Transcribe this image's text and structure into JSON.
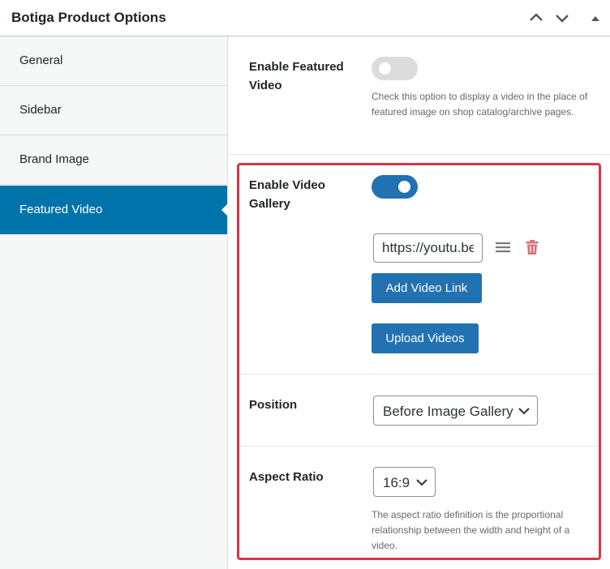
{
  "header": {
    "title": "Botiga Product Options"
  },
  "sidebar": {
    "items": [
      {
        "label": "General"
      },
      {
        "label": "Sidebar"
      },
      {
        "label": "Brand Image"
      },
      {
        "label": "Featured Video"
      }
    ],
    "active_index": 3
  },
  "main": {
    "enable_featured_video": {
      "label": "Enable Featured Video",
      "enabled": false,
      "description": "Check this option to display a video in the place of featured image on shop catalog/archive pages."
    },
    "enable_video_gallery": {
      "label": "Enable Video Gallery",
      "enabled": true,
      "video_link_value": "https://youtu.be",
      "add_button_label": "Add Video Link",
      "upload_button_label": "Upload Videos"
    },
    "position": {
      "label": "Position",
      "selected": "Before Image Gallery"
    },
    "aspect_ratio": {
      "label": "Aspect Ratio",
      "selected": "16:9",
      "description": "The aspect ratio definition is the proportional relationship between the width and height of a video."
    }
  },
  "colors": {
    "accent": "#2271b1",
    "active_tab": "#0073aa",
    "highlight": "#dc3545",
    "delete": "#d63638"
  }
}
